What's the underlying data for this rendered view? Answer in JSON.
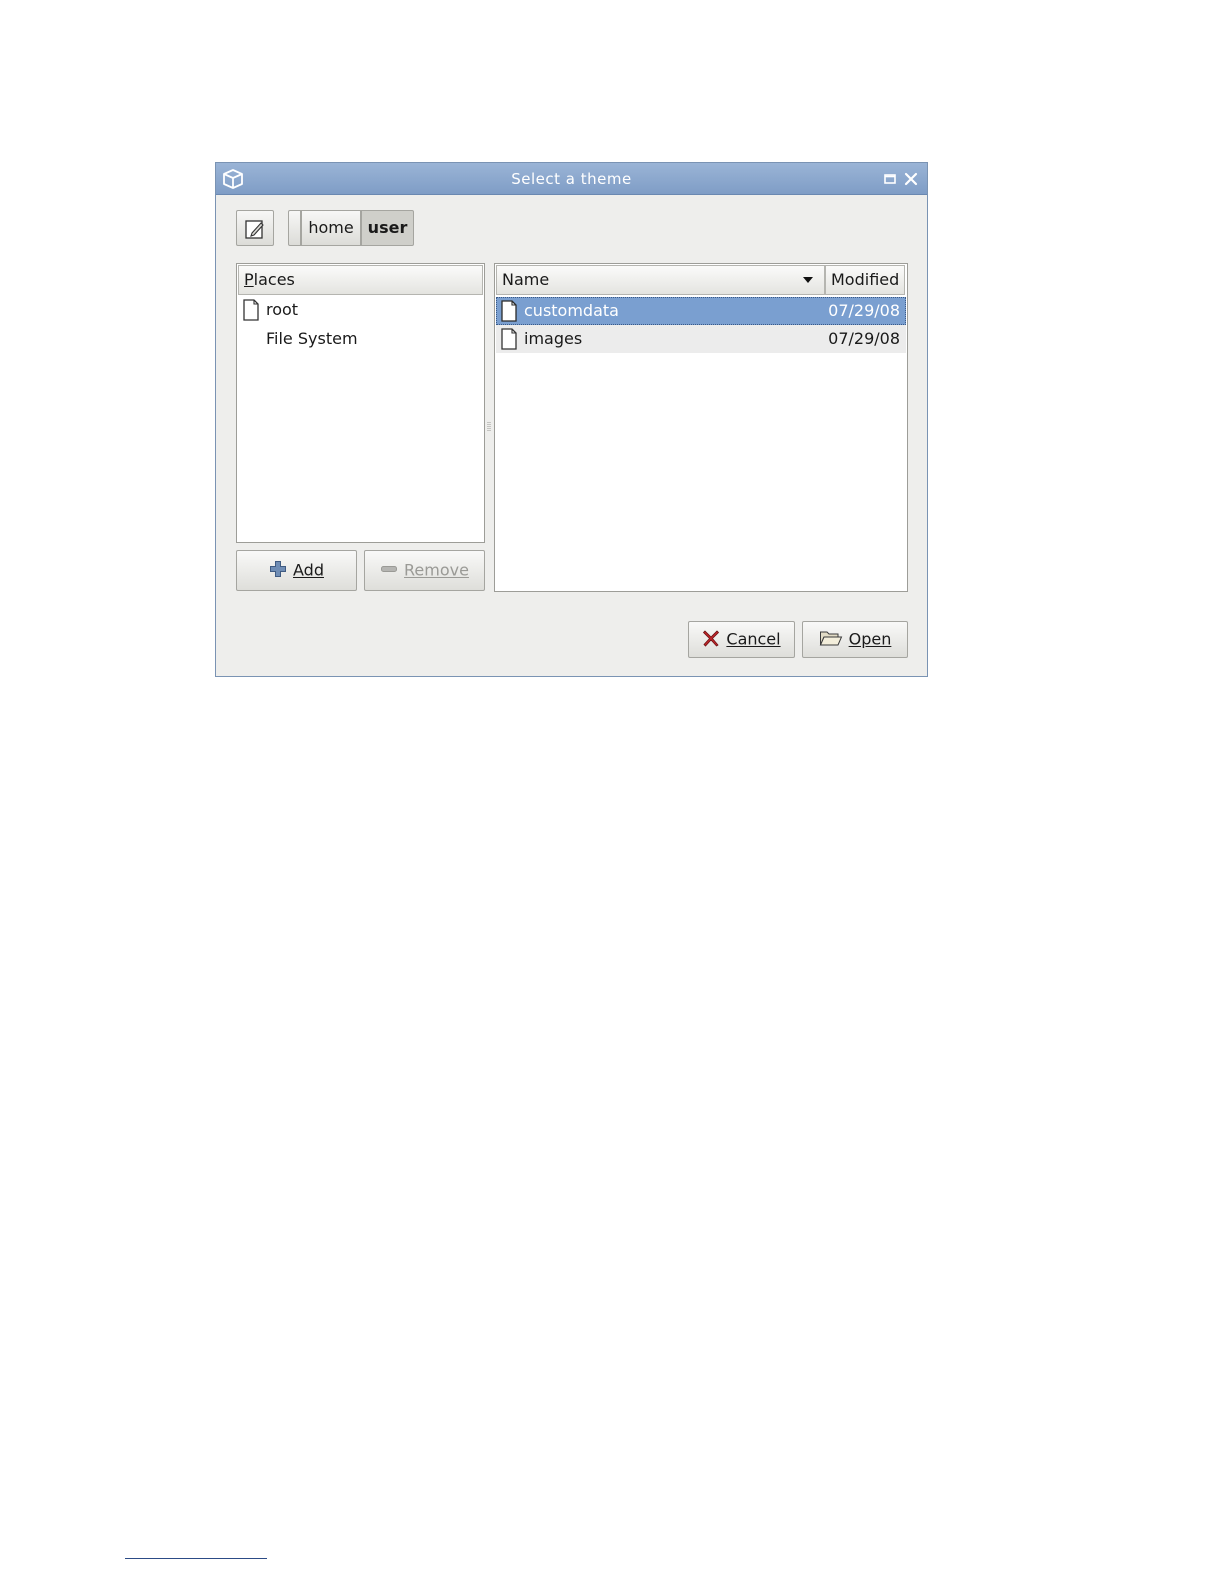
{
  "window": {
    "title": "Select a theme"
  },
  "pathbar": {
    "crumbs": [
      "home",
      "user"
    ]
  },
  "places": {
    "header": "Places",
    "items": [
      {
        "label": "root",
        "icon": "file-icon"
      },
      {
        "label": "File System",
        "icon": ""
      }
    ]
  },
  "places_buttons": {
    "add_label": "Add",
    "remove_label": "Remove"
  },
  "files": {
    "columns": {
      "name": "Name",
      "modified": "Modified"
    },
    "sort": "name-descending",
    "rows": [
      {
        "name": "customdata",
        "modified": "07/29/08",
        "selected": true
      },
      {
        "name": "images",
        "modified": "07/29/08",
        "selected": false
      }
    ]
  },
  "dialog_buttons": {
    "cancel_label": "Cancel",
    "open_label": "Open"
  },
  "colors": {
    "titlebar": "#8aa8cf",
    "selection": "#7a9fd0",
    "dialog_bg": "#eeeeec"
  }
}
